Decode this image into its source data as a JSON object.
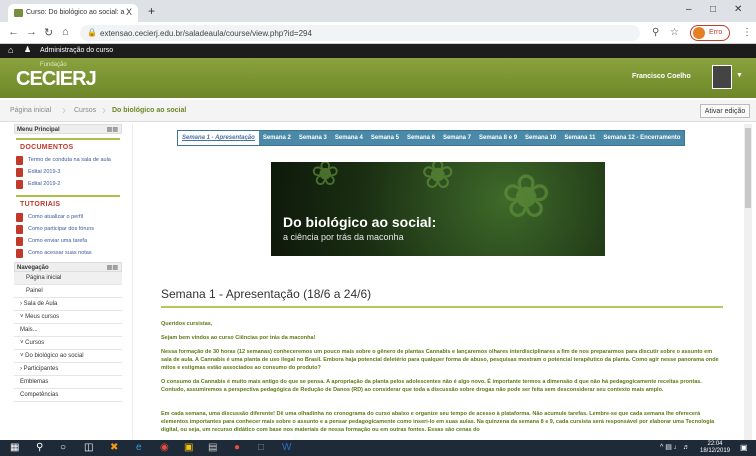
{
  "browser": {
    "tab_title": "Curso: Do biológico ao social: a",
    "tab_close": "X",
    "new_tab": "+",
    "url": "extensao.cecierj.edu.br/saladeaula/course/view.php?id=294",
    "profile_label": "Erro"
  },
  "adminbar": {
    "label": "Administração do curso"
  },
  "header": {
    "logo_sub": "Fundação",
    "logo": "CECIERJ",
    "user_name": "Francisco Coelho"
  },
  "breadcrumb": {
    "items": [
      "Página inicial",
      "Cursos",
      "Do biológico ao social"
    ],
    "edit_button": "Ativar edição"
  },
  "sidebar": {
    "main_menu_title": "Menu Principal",
    "documents_title": "DOCUMENTOS",
    "documents": [
      "Termo de conduta na sala de aula",
      "Edital 2019-3",
      "Edital 2019-2"
    ],
    "tutorials_title": "TUTORIAIS",
    "tutorials": [
      "Como atualizar o perfil",
      "Como participar dos fóruns",
      "Como enviar uma tarefa",
      "Como acessar suas notas"
    ],
    "nav_title": "Navegação",
    "nav_items": [
      "Página inicial",
      "Painel",
      "Sala de Aula",
      "Meus cursos",
      "Mais...",
      "Cursos",
      "Do biológico ao social",
      "Participantes",
      "Emblemas",
      "Competências"
    ]
  },
  "weeks": {
    "tabs": [
      "Semana 1 - Apresentação",
      "Semana 2",
      "Semana 3",
      "Semana 4",
      "Semana 5",
      "Semana 6",
      "Semana 7",
      "Semana 8 e 9",
      "Semana 10",
      "Semana 11",
      "Semana 12 - Encerramento"
    ],
    "current_index": 0
  },
  "banner": {
    "title": "Do biológico ao social:",
    "subtitle": "a ciência por trás da maconha"
  },
  "section": {
    "heading": "Semana 1 - Apresentação (18/6 a 24/6)",
    "p1": "Queridos cursistas,",
    "p2": "Sejam bem vindos ao curso Ciências por trás da maconha!",
    "p3": "Nessa formação de 30 horas (12 semanas) conheceremos um pouco mais sobre o gênero de plantas Cannabis e lançaremos olhares interdisciplinares a fim de nos prepararmos para discutir sobre o assunto em sala de aula. A Cannabis é uma planta de uso ilegal no Brasil. Embora haja potencial deletério para qualquer forma de abuso, pesquisas mostram o potencial terapêutico da planta. Como agir nesse panorama onde mitos e estigmas estão associados ao consumo do produto?",
    "p4": "O consumo da Cannabis é muito mais antigo do que se pensa. A apropriação da planta pelos adolescentes não é algo novo. É importante termos a dimensão d que não há pedagogicamente receitas prontas. Contudo, assumiremos a perspectiva pedagógica de Redução de Danos (RD) ao considerar que toda a discussão sobre drogas não pode ser feita sem desconsiderar seu contexto mais amplo.",
    "p5": "Em cada semana, uma discussão diferente! Dê uma olhadinha no cronograma do curso abaixo e organize seu tempo de acesso à plataforma. Não acumule tarefas. Lembre-se que cada semana lhe oferecerá elementos importantes para conhecer mais sobre o assunto e a pensar pedagogicamente como inseri-lo em suas aulas. Na quinzena da semana 8 e 9, cada cursista será responsável por elaborar uma Tecnologia digital, ou seja, um recurso didático com base nos materiais de nossa formação ou em outras fontes. Essas são cenas do"
  },
  "taskbar": {
    "time": "22:04",
    "date": "18/12/2019"
  },
  "colors": {
    "header_green": "#7a952f",
    "tab_blue": "#4a8aa8",
    "text_green": "#5c7a16",
    "accent_red": "#c0392b"
  }
}
